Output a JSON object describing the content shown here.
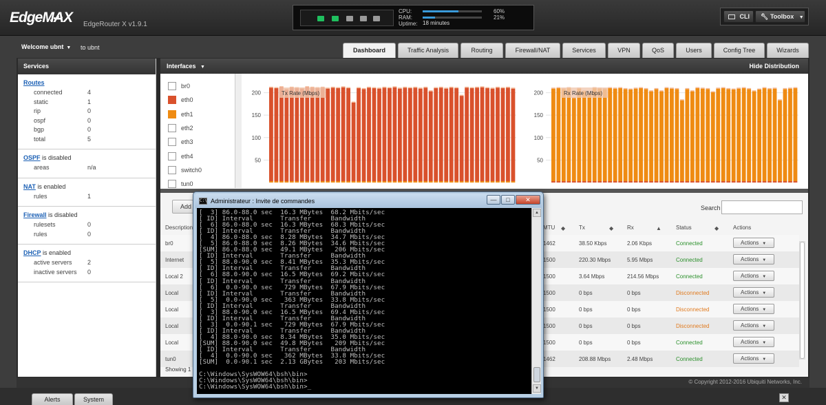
{
  "header": {
    "logo": "EdgeMAX",
    "model": "EdgeRouter X v1.9.1",
    "cpu_label": "CPU:",
    "cpu_value": "60%",
    "cpu_fraction": 0.6,
    "ram_label": "RAM:",
    "ram_value": "21%",
    "ram_fraction": 0.21,
    "uptime_label": "Uptime:",
    "uptime_value": "18 minutes",
    "port_colors": [
      "#1fbf5e",
      "#1fbf5e",
      "#9a9a9a",
      "#9a9a9a",
      "#9a9a9a"
    ],
    "cli_label": "CLI",
    "toolbox_label": "Toolbox"
  },
  "nav": {
    "welcome": "Welcome ubnt",
    "to": "to ubnt",
    "tabs": [
      "Dashboard",
      "Traffic Analysis",
      "Routing",
      "Firewall/NAT",
      "Services",
      "VPN",
      "QoS",
      "Users",
      "Config Tree",
      "Wizards"
    ]
  },
  "sidebar": {
    "title": "Services",
    "routes": {
      "link": "Routes",
      "rows": [
        {
          "k": "connected",
          "v": "4"
        },
        {
          "k": "static",
          "v": "1"
        },
        {
          "k": "rip",
          "v": "0"
        },
        {
          "k": "ospf",
          "v": "0"
        },
        {
          "k": "bgp",
          "v": "0"
        },
        {
          "k": "total",
          "v": "5"
        }
      ]
    },
    "ospf": {
      "link": "OSPF",
      "status": " is disabled",
      "rows": [
        {
          "k": "areas",
          "v": "n/a"
        }
      ]
    },
    "nat": {
      "link": "NAT",
      "status": " is enabled",
      "rows": [
        {
          "k": "rules",
          "v": "1"
        }
      ]
    },
    "firewall": {
      "link": "Firewall",
      "status": " is disabled",
      "rows": [
        {
          "k": "rulesets",
          "v": "0"
        },
        {
          "k": "rules",
          "v": "0"
        }
      ]
    },
    "dhcp": {
      "link": "DHCP",
      "status": " is enabled",
      "rows": [
        {
          "k": "active servers",
          "v": "2"
        },
        {
          "k": "inactive servers",
          "v": "0"
        }
      ]
    }
  },
  "interfaces": {
    "title": "Interfaces",
    "hide_distribution": "Hide Distribution",
    "legend": [
      {
        "name": "br0",
        "color": "#ffffff"
      },
      {
        "name": "eth0",
        "color": "#d9512c"
      },
      {
        "name": "eth1",
        "color": "#ef8b12"
      },
      {
        "name": "eth2",
        "color": "#ffffff"
      },
      {
        "name": "eth3",
        "color": "#ffffff"
      },
      {
        "name": "eth4",
        "color": "#ffffff"
      },
      {
        "name": "switch0",
        "color": "#ffffff"
      },
      {
        "name": "tun0",
        "color": "#ffffff"
      }
    ]
  },
  "chart_data": [
    {
      "type": "bar",
      "title": "Tx Rate (Mbps)",
      "ylim": [
        0,
        230
      ],
      "yticks": [
        50,
        100,
        150,
        200
      ],
      "grid": true,
      "series": [
        {
          "name": "eth0",
          "color": "#d9512c",
          "values": [
            208,
            207,
            209,
            204,
            208,
            207,
            206,
            209,
            208,
            207,
            208,
            206,
            208,
            207,
            209,
            207,
            175,
            207,
            205,
            208,
            207,
            206,
            208,
            207,
            209,
            206,
            208,
            207,
            208,
            206,
            208,
            200,
            207,
            208,
            206,
            208,
            207,
            190,
            208,
            207,
            208,
            209,
            207,
            206,
            208,
            207,
            208,
            206
          ]
        },
        {
          "name": "eth1",
          "color": "#ef8b12",
          "values": [
            3,
            3,
            3,
            3,
            3,
            3,
            3,
            3,
            3,
            3,
            3,
            3,
            3,
            3,
            3,
            3,
            3,
            3,
            3,
            3,
            3,
            3,
            3,
            3,
            3,
            3,
            3,
            3,
            3,
            3,
            3,
            3,
            3,
            3,
            3,
            3,
            3,
            3,
            3,
            3,
            3,
            3,
            3,
            3,
            3,
            3,
            3,
            3
          ]
        }
      ]
    },
    {
      "type": "bar",
      "title": "Rx Rate (Mbps)",
      "ylim": [
        0,
        230
      ],
      "yticks": [
        50,
        100,
        150,
        200
      ],
      "grid": true,
      "series": [
        {
          "name": "eth0",
          "color": "#d9512c",
          "values": [
            3,
            3,
            3,
            3,
            3,
            3,
            3,
            3,
            3,
            3,
            3,
            3,
            3,
            3,
            3,
            3,
            3,
            3,
            3,
            3,
            3,
            3,
            3,
            3,
            3,
            3,
            3,
            3,
            3,
            3,
            3,
            3,
            3,
            3,
            3,
            3,
            3,
            3,
            3,
            3,
            3,
            3,
            3,
            3,
            3,
            3,
            3,
            3
          ]
        },
        {
          "name": "eth1",
          "color": "#ef8b12",
          "values": [
            206,
            207,
            205,
            207,
            185,
            206,
            200,
            195,
            207,
            206,
            205,
            207,
            206,
            207,
            205,
            204,
            206,
            207,
            205,
            200,
            205,
            200,
            207,
            206,
            205,
            180,
            205,
            200,
            207,
            206,
            205,
            198,
            206,
            207,
            205,
            204,
            206,
            207,
            205,
            200,
            204,
            207,
            205,
            206,
            180,
            205,
            206,
            207
          ]
        }
      ]
    }
  ],
  "table": {
    "add_label": "Add",
    "search_label": "Search",
    "columns": [
      "Description",
      "MTU",
      "Tx",
      "Rx",
      "Status",
      "Actions"
    ],
    "rows": [
      {
        "desc": "br0",
        "mtu": "1462",
        "tx": "38.50 Kbps",
        "rx": "2.06 Kbps",
        "status": "Connected",
        "ok": true
      },
      {
        "desc": "Internet",
        "mtu": "1500",
        "tx": "220.30 Mbps",
        "rx": "5.95 Mbps",
        "status": "Connected",
        "ok": true
      },
      {
        "desc": "Local 2",
        "mtu": "1500",
        "tx": "3.64 Mbps",
        "rx": "214.56 Mbps",
        "status": "Connected",
        "ok": true
      },
      {
        "desc": "Local",
        "mtu": "1500",
        "tx": "0 bps",
        "rx": "0 bps",
        "status": "Disconnected",
        "ok": false
      },
      {
        "desc": "Local",
        "mtu": "1500",
        "tx": "0 bps",
        "rx": "0 bps",
        "status": "Disconnected",
        "ok": false
      },
      {
        "desc": "Local",
        "mtu": "1500",
        "tx": "0 bps",
        "rx": "0 bps",
        "status": "Disconnected",
        "ok": false
      },
      {
        "desc": "Local",
        "mtu": "1500",
        "tx": "0 bps",
        "rx": "0 bps",
        "status": "Connected",
        "ok": true
      },
      {
        "desc": "tun0",
        "mtu": "1462",
        "tx": "208.88 Mbps",
        "rx": "2.48 Mbps",
        "status": "Connected",
        "ok": true
      }
    ],
    "action_label": "Actions",
    "showing": "Showing 1"
  },
  "footer": {
    "copyright": "© Copyright 2012-2016 Ubiquiti Networks, Inc.",
    "alerts": "Alerts",
    "system": "System"
  },
  "cmd": {
    "title": "Administrateur : Invite de commandes",
    "lines": [
      "[  3] 86.0-88.0 sec  16.3 MBytes  68.2 Mbits/sec",
      "[ ID] Interval       Transfer     Bandwidth",
      "[  6] 86.0-88.0 sec  16.3 MBytes  68.3 Mbits/sec",
      "[ ID] Interval       Transfer     Bandwidth",
      "[  4] 86.0-88.0 sec  8.28 MBytes  34.7 Mbits/sec",
      "[  5] 86.0-88.0 sec  8.26 MBytes  34.6 Mbits/sec",
      "[SUM] 86.0-88.0 sec  49.1 MBytes   206 Mbits/sec",
      "[ ID] Interval       Transfer     Bandwidth",
      "[  5] 88.0-90.0 sec  8.41 MBytes  35.3 Mbits/sec",
      "[ ID] Interval       Transfer     Bandwidth",
      "[  6] 88.0-90.0 sec  16.5 MBytes  69.2 Mbits/sec",
      "[ ID] Interval       Transfer     Bandwidth",
      "[  6]  0.0-90.0 sec   729 MBytes  67.9 Mbits/sec",
      "[ ID] Interval       Transfer     Bandwidth",
      "[  5]  0.0-90.0 sec   363 MBytes  33.8 Mbits/sec",
      "[ ID] Interval       Transfer     Bandwidth",
      "[  3] 88.0-90.0 sec  16.5 MBytes  69.4 Mbits/sec",
      "[ ID] Interval       Transfer     Bandwidth",
      "[  3]  0.0-90.1 sec   729 MBytes  67.9 Mbits/sec",
      "[ ID] Interval       Transfer     Bandwidth",
      "[  4] 88.0-90.0 sec  8.34 MBytes  35.0 Mbits/sec",
      "[SUM] 88.0-90.0 sec  49.8 MBytes   209 Mbits/sec",
      "[ ID] Interval       Transfer     Bandwidth",
      "[  4]  0.0-90.0 sec   362 MBytes  33.8 Mbits/sec",
      "[SUM]  0.0-90.1 sec  2.13 GBytes   203 Mbits/sec",
      "",
      "C:\\Windows\\SysWOW64\\bsh\\bin>",
      "C:\\Windows\\SysWOW64\\bsh\\bin>",
      "C:\\Windows\\SysWOW64\\bsh\\bin>_"
    ]
  }
}
